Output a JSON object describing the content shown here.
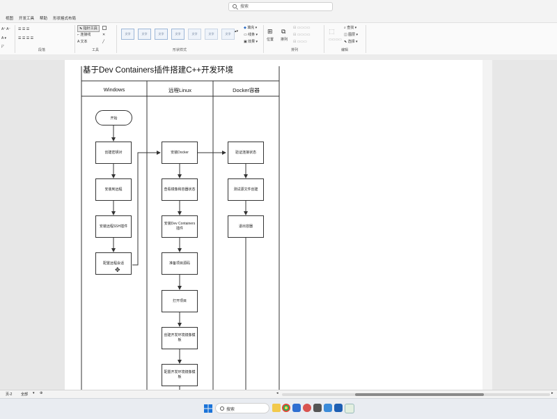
{
  "title_bar": {
    "search_placeholder": "搜索"
  },
  "menu": {
    "items": [
      "视图",
      "开发工具",
      "帮助",
      "形状格式布局"
    ]
  },
  "ribbon": {
    "pointer_tool": "指针工具",
    "connector": "连接线",
    "text": "文本",
    "group_tools": "工具",
    "group_shape_styles": "形状样式",
    "group_paragraph": "段落",
    "group_arrange": "排列",
    "group_editing": "编辑",
    "fill": "填充",
    "line": "线条",
    "effects": "效果",
    "position": "位置",
    "arrange": "排列",
    "find": "查找",
    "layers": "图层",
    "select": "选择",
    "style_swatch": "文字",
    "swatch_count": 7
  },
  "diagram": {
    "title": "基于Dev Containers插件搭建C++开发环境",
    "lanes": [
      "Windows",
      "远程Linux",
      "Docker容器"
    ],
    "windows_steps": [
      "开始",
      "创建密钥对",
      "安装到远程",
      "安装远程SSH插件",
      "配置远程会话"
    ],
    "linux_steps": [
      "安装Docker",
      "查看镜像和容器状态",
      "安装Dev Containers插件",
      "准备项目源码",
      "打开项目",
      "创建开发环境镜像模板",
      "配置开发环境镜像模板"
    ],
    "docker_steps": [
      "验证连接状态",
      "测试源文件创建",
      "退出容器"
    ]
  },
  "status": {
    "page": "页-2",
    "tab": "全部"
  },
  "taskbar": {
    "search_placeholder": "搜索"
  }
}
